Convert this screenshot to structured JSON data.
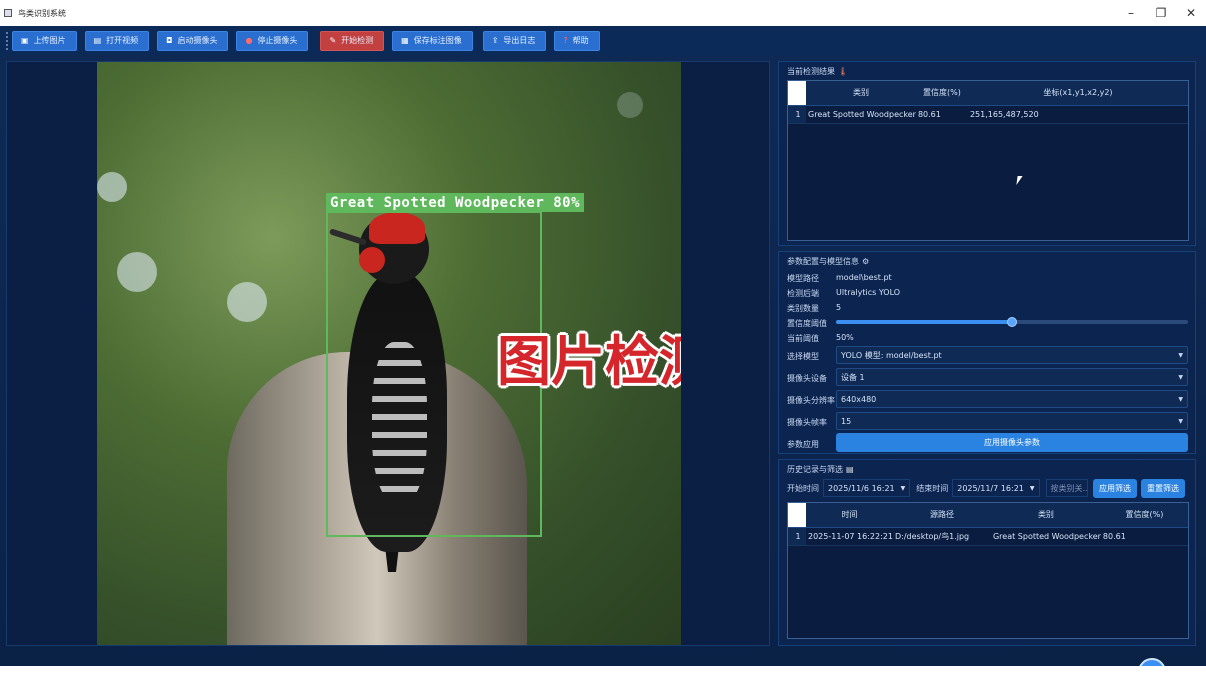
{
  "window": {
    "title": "鸟类识别系统",
    "controls": {
      "minimize": "–",
      "restore": "❐",
      "close": "✕"
    }
  },
  "toolbar": {
    "buttons": [
      {
        "label": "上传图片",
        "icon": "image-icon"
      },
      {
        "label": "打开视频",
        "icon": "video-icon"
      },
      {
        "label": "启动摄像头",
        "icon": "camera-icon"
      },
      {
        "label": "停止摄像头",
        "icon": "stop-icon"
      },
      {
        "label": "开始检测",
        "icon": "pencil-icon"
      },
      {
        "label": "保存标注图像",
        "icon": "save-icon"
      },
      {
        "label": "导出日志",
        "icon": "export-icon"
      },
      {
        "label": "帮助",
        "icon": "help-icon"
      }
    ],
    "accent": "#2a6fd0",
    "danger": "#c24040"
  },
  "viewer": {
    "detection_label": "Great Spotted Woodpecker 80%",
    "overlay_text": "图片检测"
  },
  "results": {
    "heading": "当前检测结果",
    "columns": [
      "类别",
      "置信度(%)",
      "坐标(x1,y1,x2,y2)"
    ],
    "rows": [
      {
        "num": "1",
        "cls": "Great Spotted Woodpecker",
        "conf": "80.61",
        "coords": "251,165,487,520"
      }
    ]
  },
  "params": {
    "heading": "参数配置与模型信息",
    "model_path_label": "模型路径",
    "model_path": "model\\best.pt",
    "backend_label": "检测后端",
    "backend": "Ultralytics YOLO",
    "class_count_label": "类别数量",
    "class_count": "5",
    "conf_threshold_label": "置信度阈值",
    "conf_threshold_fraction": 0.5,
    "current_threshold_label": "当前阈值",
    "current_threshold": "50%",
    "model_select_label": "选择模型",
    "model_select": "YOLO 模型: model/best.pt",
    "camera_device_label": "摄像头设备",
    "camera_device": "设备 1",
    "camera_resolution_label": "摄像头分辨率",
    "camera_resolution": "640x480",
    "camera_fps_label": "摄像头帧率",
    "camera_fps": "15",
    "apply_label": "参数应用",
    "apply_button": "应用摄像头参数"
  },
  "history": {
    "heading": "历史记录与筛选",
    "start_label": "开始时间",
    "start_value": "2025/11/6 16:21",
    "end_label": "结束时间",
    "end_value": "2025/11/7 16:21",
    "keyword_placeholder": "按类别关...",
    "apply_filter": "应用筛选",
    "reset_filter": "重置筛选",
    "columns": [
      "时间",
      "源路径",
      "类别",
      "置信度(%)"
    ],
    "rows": [
      {
        "num": "1",
        "time": "2025-11-07 16:22:21",
        "path": "D:/desktop/鸟1.jpg",
        "cls": "Great Spotted Woodpecker",
        "conf": "80.61"
      }
    ]
  }
}
